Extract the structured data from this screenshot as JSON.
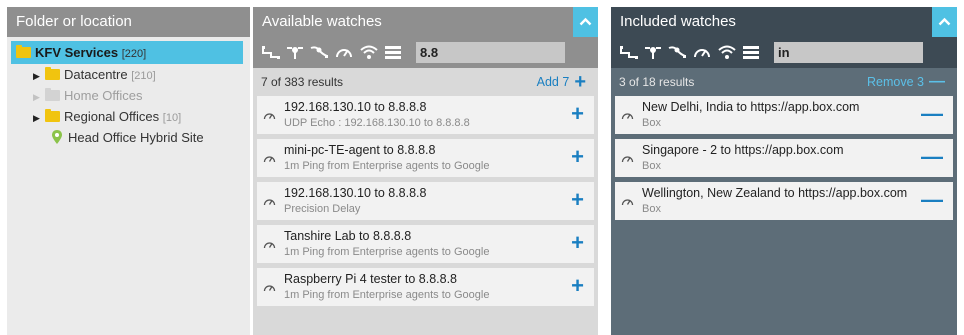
{
  "folder_panel": {
    "title": "Folder or location",
    "root": {
      "label": "KFV Services",
      "count": "[220]"
    },
    "items": [
      {
        "label": "Datacentre",
        "count": "[210]",
        "type": "folder"
      },
      {
        "label": "Home Offices",
        "count": "",
        "type": "folder-disabled"
      },
      {
        "label": "Regional Offices",
        "count": "[10]",
        "type": "folder"
      },
      {
        "label": "Head Office Hybrid Site",
        "count": "",
        "type": "location"
      }
    ]
  },
  "available": {
    "title": "Available watches",
    "search_value": "8.8",
    "count_text": "7 of 383 results",
    "action_label": "Add 7",
    "action_sign": "+",
    "items": [
      {
        "title": "192.168.130.10 to 8.8.8.8",
        "subtitle": "UDP Echo : 192.168.130.10 to 8.8.8.8"
      },
      {
        "title": "mini-pc-TE-agent to 8.8.8.8",
        "subtitle": "1m Ping from Enterprise agents to Google"
      },
      {
        "title": "192.168.130.10 to 8.8.8.8",
        "subtitle": "Precision Delay"
      },
      {
        "title": "Tanshire Lab to 8.8.8.8",
        "subtitle": "1m Ping from Enterprise agents to Google"
      },
      {
        "title": "Raspberry Pi 4 tester to 8.8.8.8",
        "subtitle": "1m Ping from Enterprise agents to Google"
      }
    ]
  },
  "included": {
    "title": "Included watches",
    "search_value": "in",
    "count_text": "3 of 18 results",
    "action_label": "Remove 3",
    "action_sign": "—",
    "items": [
      {
        "title": "New Delhi, India to https://app.box.com",
        "subtitle": "Box"
      },
      {
        "title": "Singapore - 2 to https://app.box.com",
        "subtitle": "Box"
      },
      {
        "title": "Wellington, New Zealand to https://app.box.com",
        "subtitle": "Box"
      }
    ]
  },
  "icons": {
    "toolbar": [
      "network-path-icon",
      "route-icon",
      "traffic-icon",
      "gauge-icon",
      "wifi-icon",
      "server-icon"
    ],
    "collapse": "chevron-up-icon",
    "item": "gauge-icon"
  },
  "colors": {
    "accent": "#4fc1e3",
    "link": "#1a7fc1",
    "folder": "#f1c40f",
    "included_bg": "#5d6d78"
  }
}
